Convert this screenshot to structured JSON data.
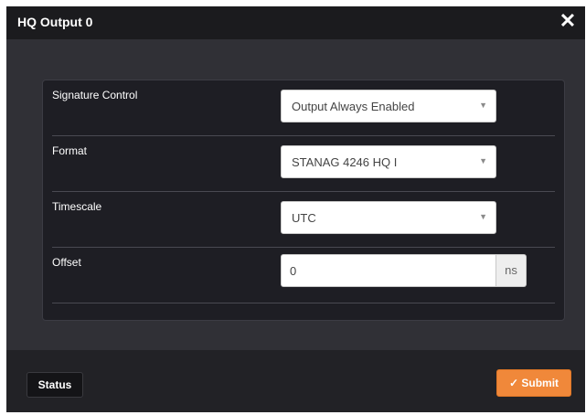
{
  "dialog": {
    "title": "HQ Output 0",
    "close_icon": "close-icon"
  },
  "form": {
    "signature_control": {
      "label": "Signature Control",
      "value": "Output Always Enabled",
      "caret_icon": "caret-down-icon"
    },
    "format": {
      "label": "Format",
      "value": "STANAG 4246 HQ I",
      "caret_icon": "caret-down-icon"
    },
    "timescale": {
      "label": "Timescale",
      "value": "UTC",
      "caret_icon": "caret-down-icon"
    },
    "offset": {
      "label": "Offset",
      "value": "0",
      "unit": "ns"
    }
  },
  "footer": {
    "status_label": "Status",
    "submit_label": "Submit",
    "submit_icon": "check-icon"
  },
  "colors": {
    "accent": "#f0883a",
    "background": "#2c2c31"
  }
}
